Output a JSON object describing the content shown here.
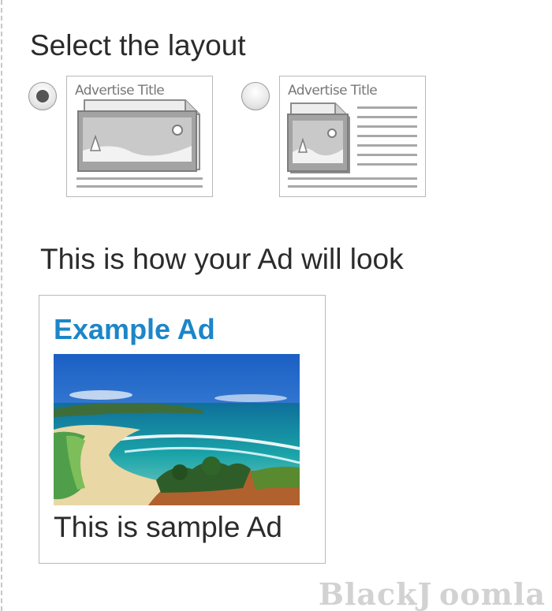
{
  "layout_selector": {
    "heading": "Select the layout",
    "options": [
      {
        "thumbnail_title": "Advertise Title",
        "selected": true
      },
      {
        "thumbnail_title": "Advertise Title",
        "selected": false
      }
    ]
  },
  "preview": {
    "heading": "This is how your Ad will look",
    "ad": {
      "title": "Example Ad",
      "image": "beach-coastline-photo",
      "body": "This is sample Ad"
    }
  },
  "watermark": "BlackJ oomla",
  "colors": {
    "ad_title": "#1c86c8",
    "text": "#2b2b2b",
    "thumbnail_gray": "#9e9e9e"
  }
}
